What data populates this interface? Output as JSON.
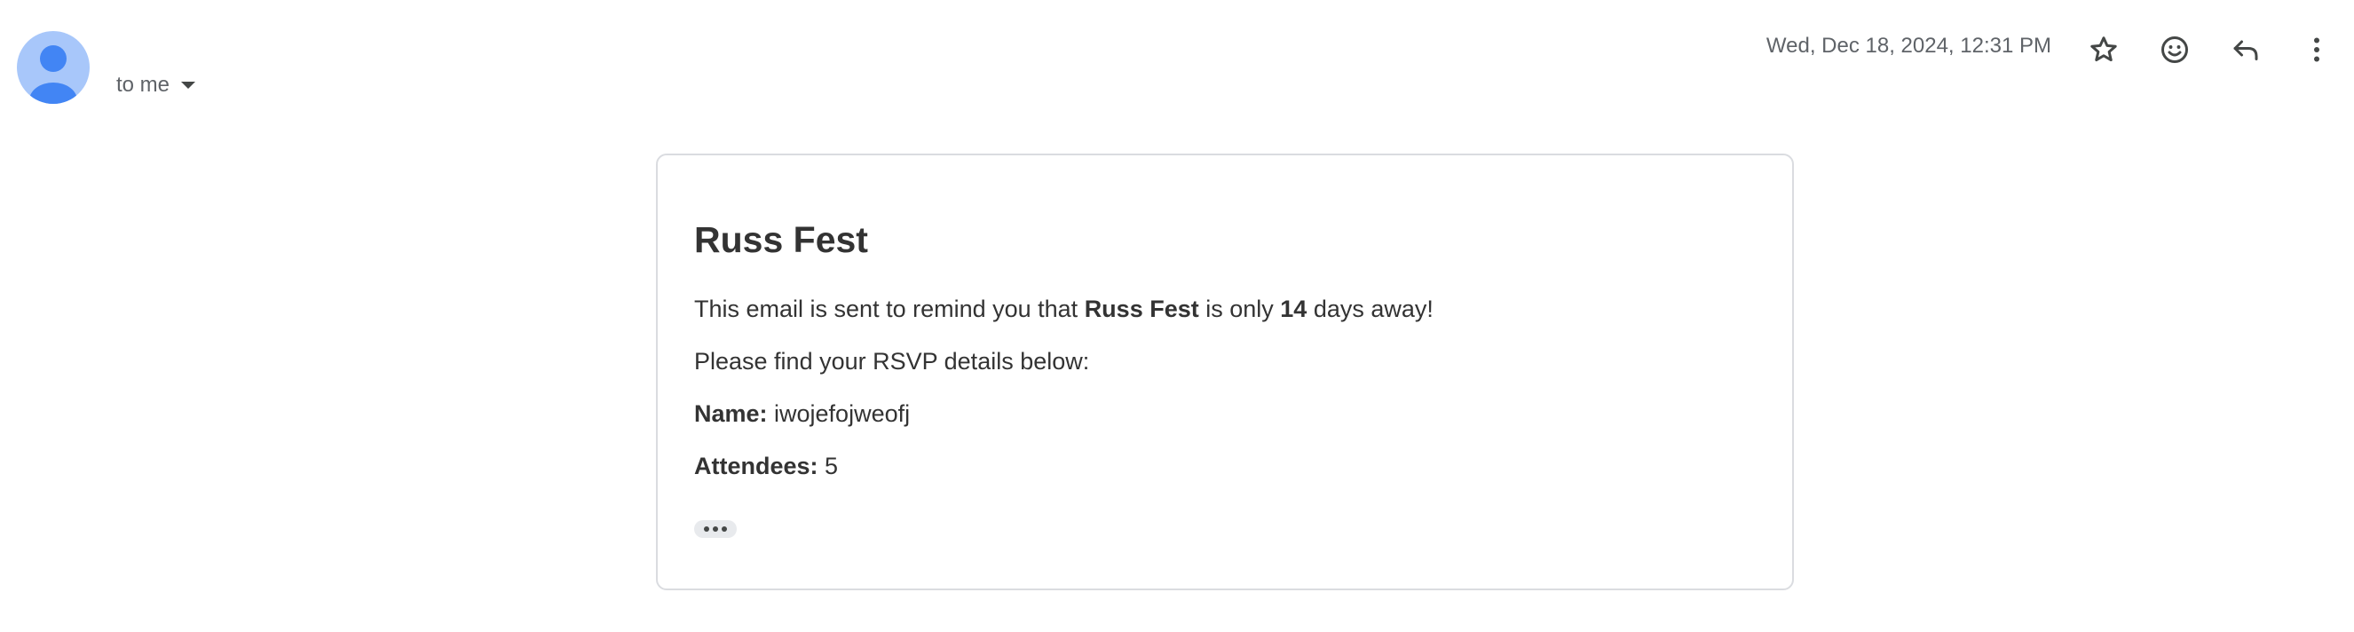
{
  "header": {
    "recipient_label": "to me",
    "date": "Wed, Dec 18, 2024, 12:31 PM",
    "icons": {
      "avatar": "default-person-avatar",
      "recipient_caret": "caret-down-icon",
      "star": "star-icon",
      "emoji": "emoji-reaction-icon",
      "reply": "reply-icon",
      "more": "more-vertical-icon"
    }
  },
  "email": {
    "title": "Russ Fest",
    "reminder": {
      "prefix": "This email is sent to remind you that ",
      "event_name": "Russ Fest",
      "middle": " is only ",
      "days": "14",
      "suffix": " days away!"
    },
    "rsvp_intro": "Please find your RSVP details below:",
    "name_label": "Name:",
    "name_value": " iwojefojweofj",
    "attendees_label": "Attendees:",
    "attendees_value": " 5",
    "show_trimmed_icon": "ellipsis-icon"
  },
  "colors": {
    "avatar_bg": "#a8c7fa",
    "avatar_fg": "#4285f4",
    "icon_gray": "#444746",
    "card_border": "#dadce0",
    "text_dark": "#333333"
  }
}
